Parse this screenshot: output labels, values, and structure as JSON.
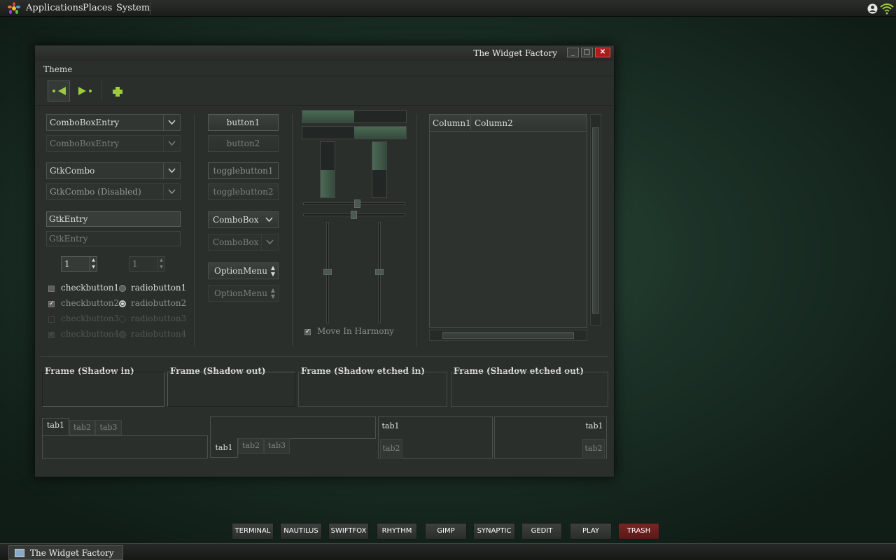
{
  "top_panel": {
    "menus": [
      "Applications",
      "Places",
      "System"
    ]
  },
  "window": {
    "title": "The Widget Factory",
    "controls": {
      "minimize": "_",
      "maximize": "□",
      "close": "✕"
    },
    "menubar": [
      "Theme"
    ],
    "col1": {
      "combo_entry": "ComboBoxEntry",
      "combo_entry_disabled": "ComboBoxEntry",
      "gtk_combo": "GtkCombo",
      "gtk_combo_disabled": "GtkCombo (Disabled)",
      "entry": "GtkEntry",
      "entry_disabled": "GtkEntry",
      "spin1": "1",
      "spin2": "1",
      "checks": [
        "checkbutton1",
        "checkbutton2",
        "checkbutton3",
        "checkbutton4"
      ],
      "radios": [
        "radiobutton1",
        "radiobutton2",
        "radiobutton3",
        "radiobutton4"
      ]
    },
    "col2": {
      "button1": "button1",
      "button2": "button2",
      "toggle1": "togglebutton1",
      "toggle2": "togglebutton2",
      "combobox": "ComboBox",
      "combobox_disabled": "ComboBox",
      "optionmenu": "OptionMenu",
      "optionmenu_disabled": "OptionMenu"
    },
    "col3": {
      "move_in_harmony": "Move In Harmony"
    },
    "treeview": {
      "columns": [
        "Column1",
        "Column2"
      ]
    },
    "frames": [
      "Frame (Shadow in)",
      "Frame (Shadow out)",
      "Frame (Shadow etched in)",
      "Frame (Shadow etched out)"
    ],
    "notebooks": {
      "nb1": [
        "tab1",
        "tab2",
        "tab3"
      ],
      "nb2": [
        "tab1",
        "tab2",
        "tab3"
      ],
      "nb3": [
        "tab1",
        "tab2"
      ],
      "nb4": [
        "tab1",
        "tab2"
      ]
    }
  },
  "launcher": [
    "TERMINAL",
    "NAUTILUS",
    "SWIFTFOX",
    "RHYTHM",
    "GIMP",
    "SYNAPTIC",
    "GEDIT",
    "PLAY",
    "TRASH"
  ],
  "taskbar": {
    "item": "The Widget Factory"
  },
  "colors": {
    "accent_green": "#9ccc3c",
    "trash_red": "#8a1f1f",
    "desktop": "#1d3328"
  }
}
